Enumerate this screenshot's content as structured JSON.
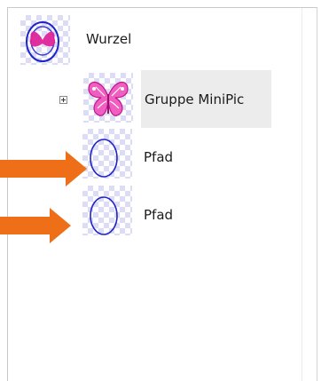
{
  "layers_panel": {
    "nodes": [
      {
        "label": "Wurzel",
        "icon": "root-layer-thumbnail-icon"
      },
      {
        "label": "Gruppe MiniPic",
        "icon": "butterfly-group-thumbnail-icon",
        "expanded": false,
        "selected": true
      },
      {
        "label": "Pfad",
        "icon": "ellipse-path-thumbnail-icon"
      },
      {
        "label": "Pfad",
        "icon": "ellipse-path-thumbnail-icon"
      }
    ]
  },
  "annotations": {
    "arrow_color": "#ee6f18",
    "arrows": [
      "pointer-arrow-path-1",
      "pointer-arrow-path-2"
    ]
  },
  "colors": {
    "accent_pink": "#e0249a",
    "ellipse_stroke": "#1f24c8",
    "checker": "#dcdcf6"
  }
}
